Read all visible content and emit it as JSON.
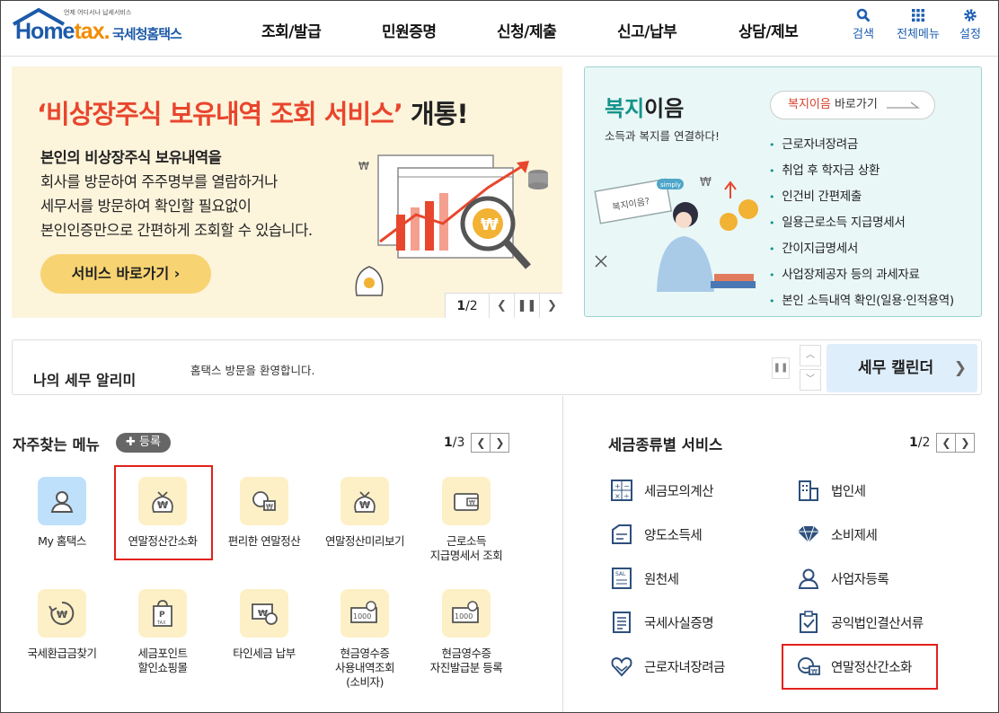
{
  "header": {
    "logo_top": "언제 어디서나 납세서비스",
    "logo_home": "Home",
    "logo_tax": "tax.",
    "logo_nts": "국세청홈택스",
    "nav": [
      "조회/발급",
      "민원증명",
      "신청/제출",
      "신고/납부",
      "상담/제보"
    ],
    "util": {
      "search": "검색",
      "all_menu": "전체메뉴",
      "settings": "설정"
    }
  },
  "banner_left": {
    "title_quote_open": "‘비상장주식 ",
    "title_mid": "보유내역 조회 서비스’",
    "title_end": " 개통!",
    "line1": "본인의 비상장주식 보유내역을",
    "line2": "회사를 방문하여 주주명부를 열람하거나",
    "line3": "세무서를 방문하여 확인할 필요없이",
    "line4": "본인인증만으로 간편하게 조회할 수 있습니다.",
    "button": "서비스 바로가기 ›",
    "page_current": "1",
    "page_total": "/2"
  },
  "banner_right": {
    "title_teal": "복지",
    "title_rest": "이음",
    "subtitle": "소득과 복지를 연결하다!",
    "link_red": "복지이음",
    "link_rest": " 바로가기",
    "sign_text": "복지이음?",
    "bubble": "simply",
    "items": [
      "근로자녀장려금",
      "취업 후 학자금 상환",
      "인건비 간편제출",
      "일용근로소득 지급명세서",
      "간이지급명세서",
      "사업장제공자 등의 과세자료",
      "본인 소득내역 확인(일용·인적용역)"
    ]
  },
  "alarm": {
    "title": "나의 세무 알리미",
    "message": "홈택스 방문을 환영합니다.",
    "calendar": "세무 캘린더"
  },
  "freq": {
    "title": "자주찾는 메뉴",
    "register": "등록",
    "page_current": "1",
    "page_total": "/3",
    "tiles": [
      {
        "label": "My 홈택스"
      },
      {
        "label": "연말정산간소화"
      },
      {
        "label": "편리한 연말정산"
      },
      {
        "label": "연말정산미리보기"
      },
      {
        "label": "근로소득\n지급명세서 조회"
      },
      {
        "label": "국세환급금찾기"
      },
      {
        "label": "세금포인트\n할인쇼핑몰"
      },
      {
        "label": "타인세금 납부"
      },
      {
        "label": "현금영수증\n사용내역조회\n(소비자)"
      },
      {
        "label": "현금영수증\n자진발급분 등록"
      }
    ]
  },
  "services": {
    "title": "세금종류별 서비스",
    "page_current": "1",
    "page_total": "/2",
    "items": [
      "세금모의계산",
      "법인세",
      "양도소득세",
      "소비제세",
      "원천세",
      "사업자등록",
      "국세사실증명",
      "공익법인결산서류",
      "근로자녀장려금",
      "연말정산간소화"
    ]
  },
  "colors": {
    "brand_blue": "#1c5aa8",
    "accent_orange": "#f28c00",
    "highlight_red": "#e2211c",
    "teal": "#13938a"
  }
}
